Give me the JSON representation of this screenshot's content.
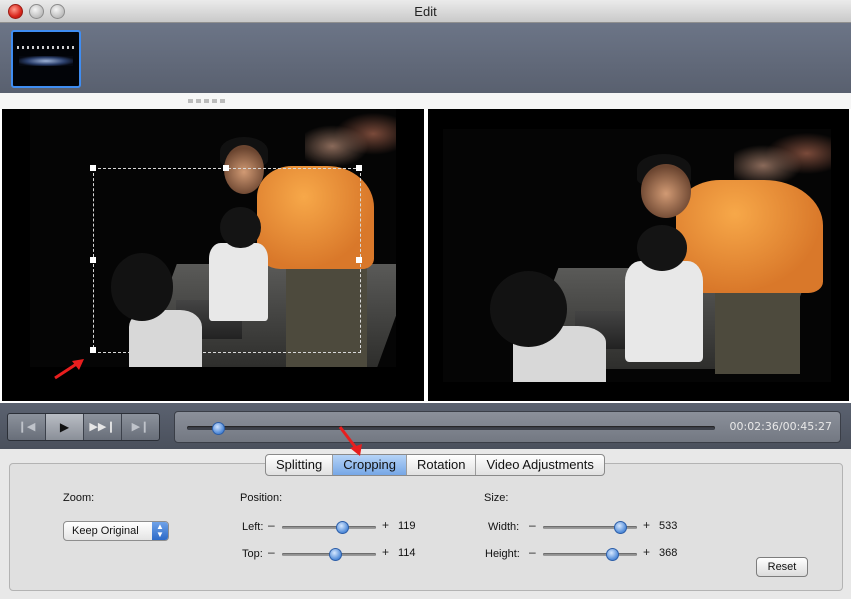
{
  "window": {
    "title": "Edit"
  },
  "preview": {
    "time_display": "00:02:36/00:45:27",
    "progress": 0.057
  },
  "transport": {
    "prev_icon": "skip-back-icon",
    "play_icon": "play-icon",
    "step_icon": "fast-forward-icon",
    "next_icon": "skip-forward-icon"
  },
  "tabs": [
    {
      "label": "Splitting",
      "active": false
    },
    {
      "label": "Cropping",
      "active": true
    },
    {
      "label": "Rotation",
      "active": false
    },
    {
      "label": "Video Adjustments",
      "active": false
    }
  ],
  "cropping": {
    "zoom_label": "Zoom:",
    "zoom_value": "Keep Original",
    "position_label": "Position:",
    "left_label": "Left:",
    "left_value": "119",
    "top_label": "Top:",
    "top_value": "114",
    "size_label": "Size:",
    "width_label": "Width:",
    "width_value": "533",
    "height_label": "Height:",
    "height_value": "368",
    "reset_label": "Reset"
  },
  "colors": {
    "accent": "#4b86d6",
    "annotation_red": "#e81e1e"
  }
}
